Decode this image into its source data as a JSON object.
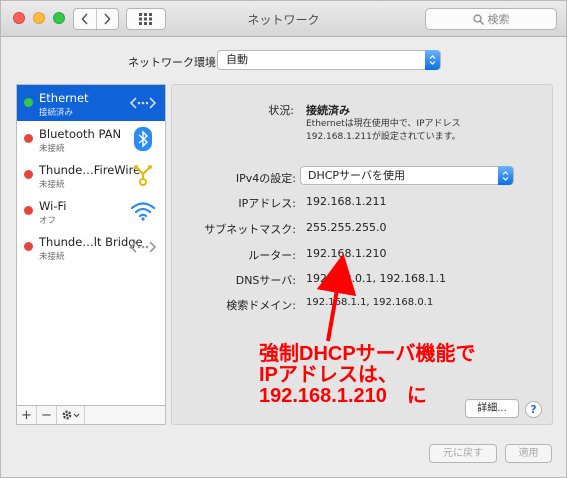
{
  "window": {
    "title": "ネットワーク"
  },
  "search": {
    "placeholder": "検索"
  },
  "location": {
    "label": "ネットワーク環境:",
    "value": "自動"
  },
  "services": [
    {
      "name": "Ethernet",
      "status": "接続済み",
      "dot_color": "#34c84a",
      "icon": "ethernet-icon"
    },
    {
      "name": "Bluetooth PAN",
      "status": "未接続",
      "dot_color": "#e8443c",
      "icon": "bluetooth-icon"
    },
    {
      "name": "Thunde…FireWire",
      "status": "未接続",
      "dot_color": "#e8443c",
      "icon": "firewire-icon"
    },
    {
      "name": "Wi-Fi",
      "status": "オフ",
      "dot_color": "#e8443c",
      "icon": "wifi-icon"
    },
    {
      "name": "Thunde…lt Bridge",
      "status": "未接続",
      "dot_color": "#e8443c",
      "icon": "thunderbolt-bridge-icon"
    }
  ],
  "sidebar_controls": {
    "add": "+",
    "remove": "−"
  },
  "detail": {
    "status_label": "状況:",
    "status_value": "接続済み",
    "status_desc_1": "Ethernetは現在使用中で、IPアドレス",
    "status_desc_2": "192.168.1.211が設定されています。",
    "ipv4_label": "IPv4の設定:",
    "ipv4_value": "DHCPサーバを使用",
    "ip_label": "IPアドレス:",
    "ip_value": "192.168.1.211",
    "subnet_label": "サブネットマスク:",
    "subnet_value": "255.255.255.0",
    "router_label": "ルーター:",
    "router_value": "192.168.1.210",
    "dns_label": "DNSサーバ:",
    "dns_value": "192.168.0.1, 192.168.1.1",
    "searchdomain_label": "検索ドメイン:",
    "searchdomain_value": "192.168.1.1, 192.168.0.1",
    "advanced_button": "詳細...",
    "help_button": "?"
  },
  "footer": {
    "revert_button": "元に戻す",
    "apply_button": "適用"
  },
  "annotation": {
    "line1": "強制DHCPサーバ機能で",
    "line2": "IPアドレスは、",
    "line3": "192.168.1.210　に",
    "color": "#ff0000"
  }
}
